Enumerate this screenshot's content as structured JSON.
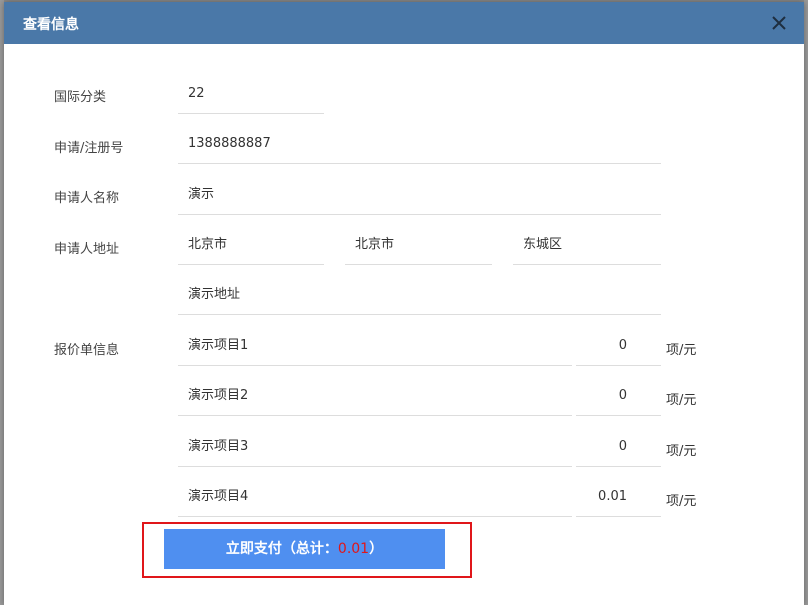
{
  "dialog": {
    "title": "查看信息"
  },
  "form": {
    "class_label": "国际分类",
    "class_value": "22",
    "reg_label": "申请/注册号",
    "reg_value": "1388888887",
    "applicant_label": "申请人名称",
    "applicant_value": "演示",
    "address_label": "申请人地址",
    "address_province": "北京市",
    "address_city": "北京市",
    "address_district": "东城区",
    "address_detail": "演示地址",
    "quote_label": "报价单信息",
    "quote_items": [
      {
        "name": "演示项目1",
        "price": "0",
        "unit": "项/元"
      },
      {
        "name": "演示项目2",
        "price": "0",
        "unit": "项/元"
      },
      {
        "name": "演示项目3",
        "price": "0",
        "unit": "项/元"
      },
      {
        "name": "演示项目4",
        "price": "0.01",
        "unit": "项/元"
      }
    ]
  },
  "pay": {
    "label_prefix": "立即支付（总计：",
    "total": "0.01",
    "label_suffix": "）"
  },
  "colors": {
    "header": "#4a78a8",
    "pay_button": "#4f8ff0",
    "highlight": "#e0161a"
  },
  "icons": {
    "close": "close-icon"
  }
}
